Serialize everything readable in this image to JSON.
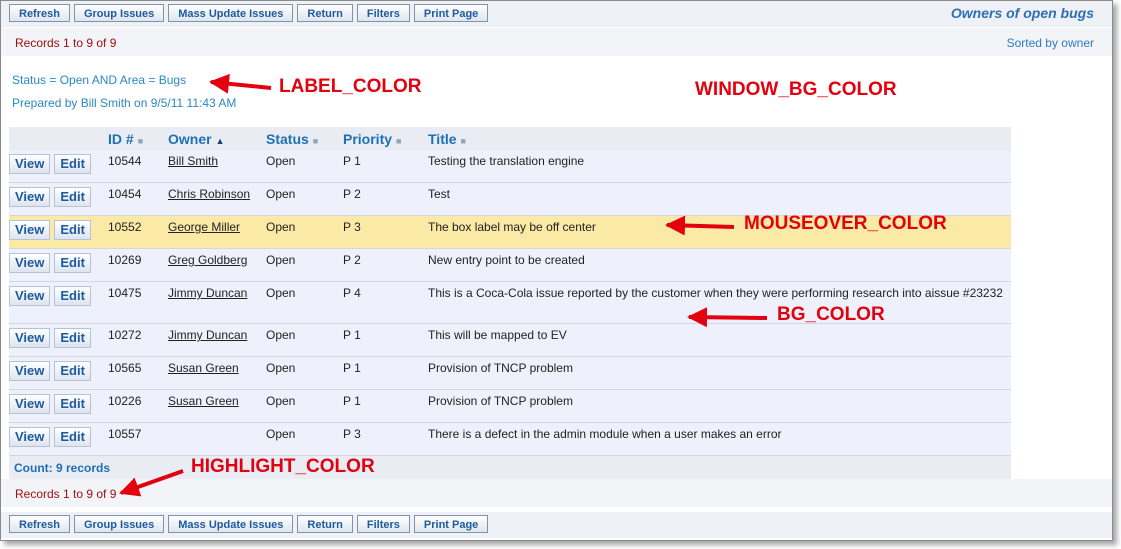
{
  "toolbar": {
    "buttons": [
      "Refresh",
      "Group Issues",
      "Mass Update Issues",
      "Return",
      "Filters",
      "Print Page"
    ]
  },
  "page": {
    "title": "Owners of open bugs",
    "records": "Records 1 to 9 of 9",
    "sorted_by": "Sorted by owner",
    "criteria": "Status = Open AND Area = Bugs",
    "prepared_by": "Prepared by Bill Smith on 9/5/11 11:43 AM"
  },
  "table": {
    "columns": [
      "ID #",
      "Owner",
      "Status",
      "Priority",
      "Title"
    ],
    "sort_column": "Owner",
    "view_label": "View",
    "edit_label": "Edit",
    "rows": [
      {
        "id": "10544",
        "owner": "Bill Smith",
        "status": "Open",
        "priority": "P 1",
        "title": "Testing the translation engine"
      },
      {
        "id": "10454",
        "owner": "Chris Robinson",
        "status": "Open",
        "priority": "P 2",
        "title": "Test"
      },
      {
        "id": "10552",
        "owner": "George Miller",
        "status": "Open",
        "priority": "P 3",
        "title": "The box label may be off center"
      },
      {
        "id": "10269",
        "owner": "Greg Goldberg",
        "status": "Open",
        "priority": "P 2",
        "title": "New entry point to be created"
      },
      {
        "id": "10475",
        "owner": "Jimmy Duncan",
        "status": "Open",
        "priority": "P 4",
        "title": "This is a Coca-Cola issue reported by the customer when they were performing research into aissue #23232"
      },
      {
        "id": "10272",
        "owner": "Jimmy Duncan",
        "status": "Open",
        "priority": "P 1",
        "title": "This will be mapped to EV"
      },
      {
        "id": "10565",
        "owner": "Susan Green",
        "status": "Open",
        "priority": "P 1",
        "title": "Provision of TNCP problem"
      },
      {
        "id": "10226",
        "owner": "Susan Green",
        "status": "Open",
        "priority": "P 1",
        "title": "Provision of TNCP problem"
      },
      {
        "id": "10557",
        "owner": "",
        "status": "Open",
        "priority": "P 3",
        "title": "There is a defect in the admin module when a user makes an error"
      }
    ],
    "count": "Count: 9 records"
  },
  "callouts": {
    "label_color": "LABEL_COLOR",
    "window_bg_color": "WINDOW_BG_COLOR",
    "mouseover_color": "MOUSEOVER_COLOR",
    "bg_color": "BG_COLOR",
    "highlight_color": "HIGHLIGHT_COLOR"
  },
  "colors": {
    "link_blue": "#1d5aa0",
    "records_red": "#a01010",
    "row_bg": "#eef0fc",
    "mouseover": "#fbe9a6",
    "callout_red": "#e3000f"
  }
}
